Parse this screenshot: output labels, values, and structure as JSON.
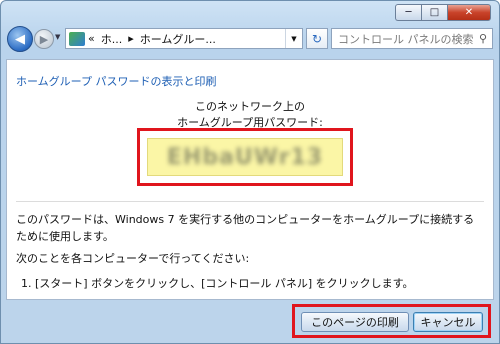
{
  "titlebar": {
    "minimize_glyph": "─",
    "maximize_glyph": "□",
    "close_glyph": "✕"
  },
  "nav": {
    "back_glyph": "◀",
    "forward_glyph": "▶",
    "dropdown_glyph": "▼",
    "address_segments": [
      "«",
      "ホ...",
      "▸",
      "ホームグルー..."
    ],
    "address_dropdown_glyph": "▼",
    "refresh_glyph": "↻",
    "search_placeholder": "コントロール パネルの検索",
    "search_glyph": "⚲"
  },
  "content": {
    "heading": "ホームグループ パスワードの表示と印刷",
    "pw_label_line1": "このネットワーク上の",
    "pw_label_line2": "ホームグループ用パスワード:",
    "password_blurred": "EHbaUWr13",
    "para1": "このパスワードは、Windows 7 を実行する他のコンピューターをホームグループに接続するために使用します。",
    "para2": "次のことを各コンピューターで行ってください:",
    "step1": "1.  [スタート] ボタンをクリックし、[コントロール パネル] をクリックします。"
  },
  "buttons": {
    "print": "このページの印刷",
    "cancel": "キャンセル"
  },
  "colors": {
    "highlight_red": "#e0151d",
    "password_bg": "#fbf6a6",
    "heading_blue": "#1e5fb4"
  }
}
